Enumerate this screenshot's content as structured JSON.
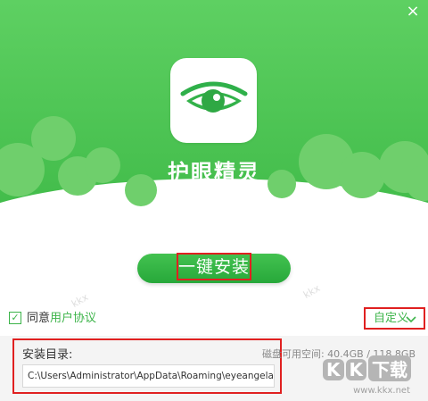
{
  "window": {
    "close_glyph": "×"
  },
  "app": {
    "name": "护眼精灵",
    "icon_name": "eye-icon",
    "brand_color": "#3db44a"
  },
  "install": {
    "button_label": "一键安装"
  },
  "agreement": {
    "checked": true,
    "check_glyph": "✓",
    "prefix": "同意",
    "link_text": "用户协议"
  },
  "custom": {
    "label": "自定义",
    "chevron_icon": "chevron-down-icon"
  },
  "directory": {
    "label": "安装目录:",
    "disk_info": "磁盘可用空间: 40.4GB / 118.8GB",
    "path": "C:\\Users\\Administrator\\AppData\\Roaming\\eyeangelapp"
  },
  "watermark": {
    "logo_letters": [
      "K",
      "K",
      "下载"
    ],
    "url": "www.kkx.net"
  }
}
